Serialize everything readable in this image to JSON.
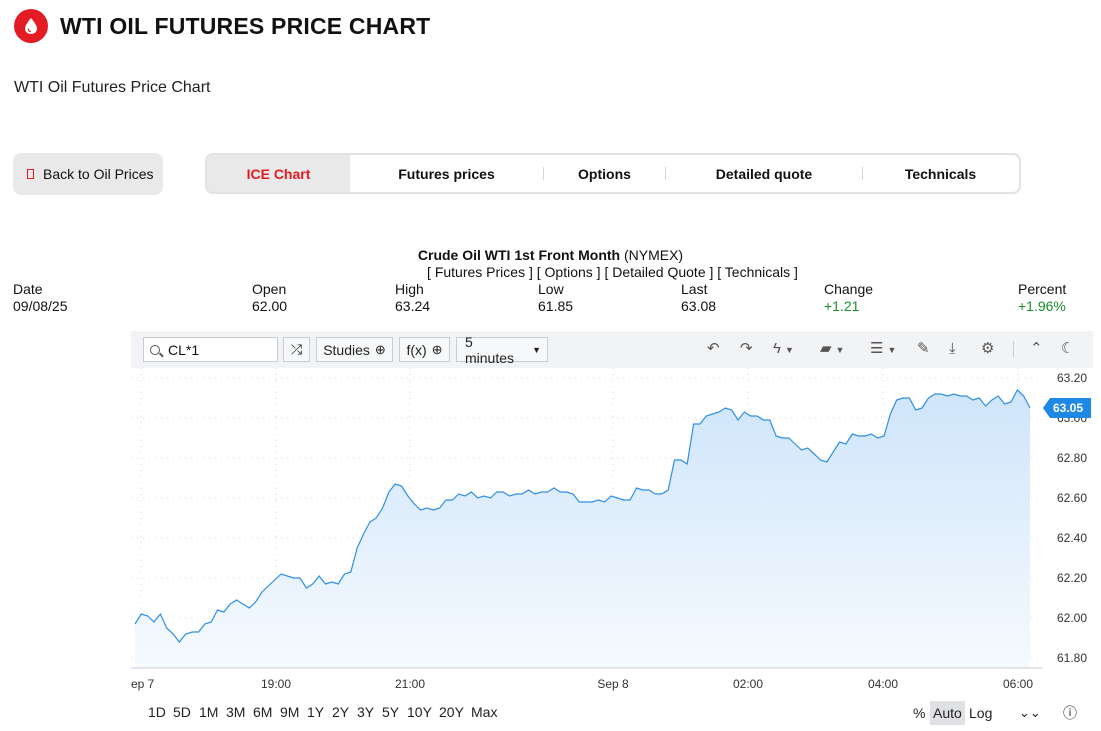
{
  "header": {
    "title": "WTI OIL FUTURES PRICE CHART",
    "subtitle": "WTI Oil Futures Price Chart",
    "brand_color": "#e31b23"
  },
  "back_button": {
    "label": "Back to Oil Prices"
  },
  "tabs": [
    {
      "label": "ICE Chart",
      "active": true
    },
    {
      "label": "Futures prices",
      "active": false
    },
    {
      "label": "Options",
      "active": false
    },
    {
      "label": "Detailed quote",
      "active": false
    },
    {
      "label": "Technicals",
      "active": false
    }
  ],
  "quote": {
    "name": "Crude Oil WTI 1st Front Month",
    "exchange": "(NYMEX)",
    "links": "[ Futures Prices ] [ Options ] [ Detailed Quote ] [ Technicals ]",
    "stats": [
      {
        "label": "Date",
        "value": "09/08/25"
      },
      {
        "label": "Open",
        "value": "62.00"
      },
      {
        "label": "High",
        "value": "63.24"
      },
      {
        "label": "Low",
        "value": "61.85"
      },
      {
        "label": "Last",
        "value": "63.08"
      },
      {
        "label": "Change",
        "value": "+1.21"
      },
      {
        "label": "Percent",
        "value": "+1.96%"
      }
    ]
  },
  "toolbar": {
    "symbol": "CL*1",
    "studies": "Studies",
    "fx": "f(x)",
    "interval": "5 minutes",
    "icons": [
      "undo-icon",
      "redo-icon",
      "drawing-tools-icon",
      "chart-type-icon",
      "layout-icon",
      "pencil-icon",
      "download-icon",
      "settings-icon",
      "collapse-icon",
      "dark-mode-icon"
    ]
  },
  "chart_data": {
    "type": "area",
    "ylim": [
      61.75,
      63.25
    ],
    "y_ticks": [
      "63.20",
      "63.00",
      "62.80",
      "62.60",
      "62.40",
      "62.20",
      "62.00",
      "61.80"
    ],
    "x_ticks": [
      "ep 7",
      "19:00",
      "21:00",
      "Sep 8",
      "02:00",
      "04:00",
      "06:00"
    ],
    "last_price_label": "63.05",
    "line_color": "#2f8fe6",
    "values": [
      61.97,
      62.02,
      62.01,
      61.98,
      62.02,
      61.95,
      61.92,
      61.88,
      61.92,
      61.93,
      61.93,
      61.97,
      61.98,
      62.04,
      62.03,
      62.07,
      62.09,
      62.07,
      62.05,
      62.08,
      62.13,
      62.16,
      62.19,
      62.22,
      62.21,
      62.2,
      62.2,
      62.15,
      62.17,
      62.21,
      62.17,
      62.18,
      62.17,
      62.22,
      62.23,
      62.35,
      62.42,
      62.48,
      62.5,
      62.55,
      62.63,
      62.67,
      62.66,
      62.61,
      62.57,
      62.54,
      62.55,
      62.54,
      62.55,
      62.59,
      62.59,
      62.62,
      62.61,
      62.63,
      62.6,
      62.61,
      62.6,
      62.63,
      62.63,
      62.61,
      62.62,
      62.62,
      62.64,
      62.62,
      62.63,
      62.63,
      62.65,
      62.63,
      62.63,
      62.62,
      62.58,
      62.58,
      62.58,
      62.59,
      62.58,
      62.61,
      62.6,
      62.59,
      62.59,
      62.65,
      62.64,
      62.64,
      62.62,
      62.62,
      62.64,
      62.79,
      62.79,
      62.77,
      62.97,
      62.97,
      63.01,
      63.02,
      63.03,
      63.05,
      63.04,
      62.99,
      63.03,
      63.01,
      63.01,
      62.99,
      62.99,
      62.91,
      62.9,
      62.9,
      62.87,
      62.84,
      62.85,
      62.82,
      62.79,
      62.78,
      62.83,
      62.88,
      62.87,
      62.92,
      62.91,
      62.91,
      62.92,
      62.9,
      62.91,
      63.02,
      63.09,
      63.1,
      63.1,
      63.04,
      63.05,
      63.1,
      63.12,
      63.12,
      63.11,
      63.12,
      63.11,
      63.11,
      63.09,
      63.1,
      63.06,
      63.09,
      63.11,
      63.07,
      63.08,
      63.14,
      63.11,
      63.05
    ]
  },
  "range_buttons": [
    "1D",
    "5D",
    "1M",
    "3M",
    "6M",
    "9M",
    "1Y",
    "2Y",
    "3Y",
    "5Y",
    "10Y",
    "20Y",
    "Max"
  ],
  "scale_buttons": [
    "%",
    "Auto",
    "Log"
  ]
}
